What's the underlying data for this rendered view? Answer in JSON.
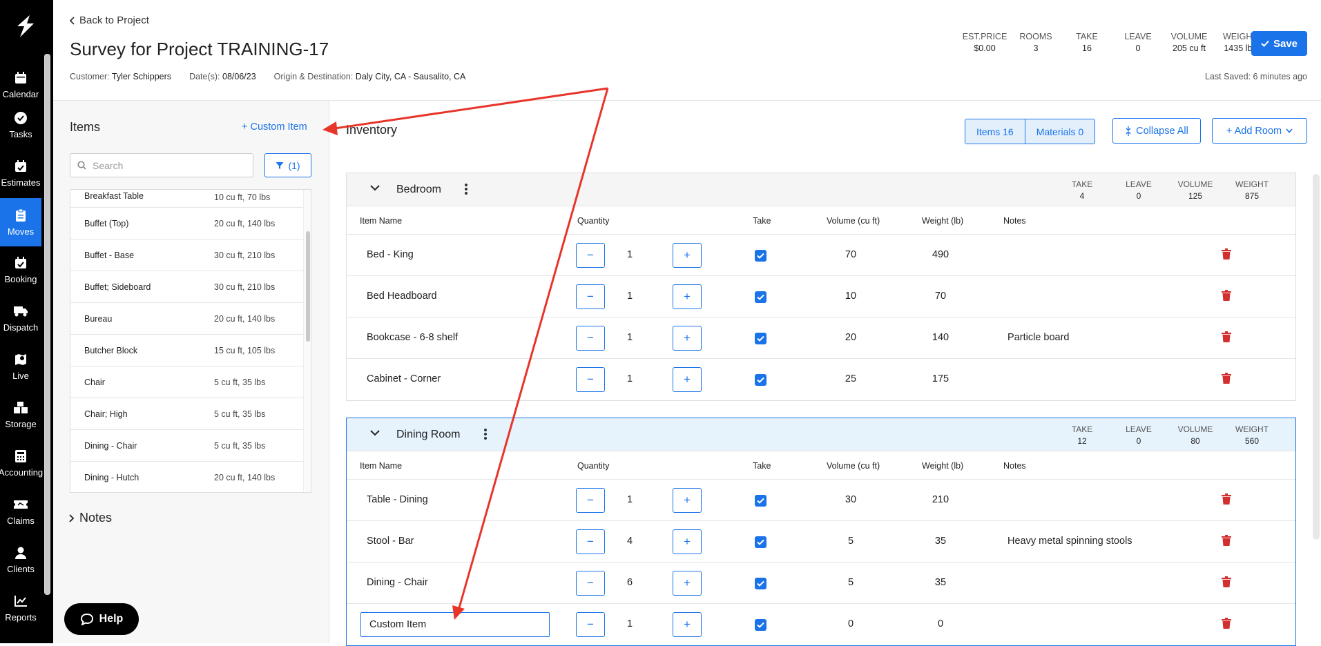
{
  "nav": {
    "items": [
      {
        "label": "Calendar",
        "icon": "calendar-icon"
      },
      {
        "label": "Tasks",
        "icon": "check-circle-icon"
      },
      {
        "label": "Estimates",
        "icon": "calendar-check-icon"
      },
      {
        "label": "Moves",
        "icon": "clipboard-icon",
        "active": true
      },
      {
        "label": "Booking",
        "icon": "calendar-check-icon"
      },
      {
        "label": "Dispatch",
        "icon": "truck-icon"
      },
      {
        "label": "Live",
        "icon": "map-pin-icon"
      },
      {
        "label": "Storage",
        "icon": "boxes-icon"
      },
      {
        "label": "Accounting",
        "icon": "calculator-icon"
      },
      {
        "label": "Claims",
        "icon": "ticket-icon"
      },
      {
        "label": "Clients",
        "icon": "user-icon"
      },
      {
        "label": "Reports",
        "icon": "chart-line-icon"
      }
    ]
  },
  "header": {
    "back_label": "Back to Project",
    "title": "Survey for Project TRAINING-17",
    "customer_label": "Customer:",
    "customer": "Tyler Schippers",
    "dates_label": "Date(s):",
    "dates": "08/06/23",
    "origin_label": "Origin & Destination:",
    "origin": "Daly City, CA - Sausalito, CA",
    "stats": [
      {
        "label": "EST.PRICE",
        "value": "$0.00"
      },
      {
        "label": "ROOMS",
        "value": "3"
      },
      {
        "label": "TAKE",
        "value": "16"
      },
      {
        "label": "LEAVE",
        "value": "0"
      },
      {
        "label": "VOLUME",
        "value": "205 cu ft"
      },
      {
        "label": "WEIGHT",
        "value": "1435 lbs"
      }
    ],
    "save_label": "Save",
    "last_saved": "Last Saved: 6 minutes ago"
  },
  "items_panel": {
    "title": "Items",
    "custom_item_label": "+ Custom Item",
    "search_placeholder": "Search",
    "filter_label": "(1)",
    "items": [
      {
        "name": "Breakfast Table",
        "detail": "10 cu ft, 70 lbs"
      },
      {
        "name": "Buffet (Top)",
        "detail": "20 cu ft, 140 lbs"
      },
      {
        "name": "Buffet - Base",
        "detail": "30 cu ft, 210 lbs"
      },
      {
        "name": "Buffet; Sideboard",
        "detail": "30 cu ft, 210 lbs"
      },
      {
        "name": "Bureau",
        "detail": "20 cu ft, 140 lbs"
      },
      {
        "name": "Butcher Block",
        "detail": "15 cu ft, 105 lbs"
      },
      {
        "name": "Chair",
        "detail": "5 cu ft, 35 lbs"
      },
      {
        "name": "Chair; High",
        "detail": "5 cu ft, 35 lbs"
      },
      {
        "name": "Dining - Chair",
        "detail": "5 cu ft, 35 lbs"
      },
      {
        "name": "Dining - Hutch",
        "detail": "20 cu ft, 140 lbs"
      }
    ],
    "notes_label": "Notes",
    "help_label": "Help"
  },
  "inventory": {
    "title": "Inventory",
    "items_tab": "Items 16",
    "materials_tab": "Materials 0",
    "collapse_label": "Collapse All",
    "add_room_label": "+ Add Room",
    "columns": {
      "name": "Item Name",
      "quantity": "Quantity",
      "take": "Take",
      "volume": "Volume (cu ft)",
      "weight": "Weight (lb)",
      "notes": "Notes"
    },
    "stat_labels": {
      "take": "TAKE",
      "leave": "LEAVE",
      "volume": "VOLUME",
      "weight": "WEIGHT"
    },
    "rooms": [
      {
        "name": "Bedroom",
        "take": "4",
        "leave": "0",
        "volume": "125",
        "weight": "875",
        "items": [
          {
            "name": "Bed - King",
            "qty": "1",
            "volume": "70",
            "weight": "490",
            "notes": ""
          },
          {
            "name": "Bed Headboard",
            "qty": "1",
            "volume": "10",
            "weight": "70",
            "notes": ""
          },
          {
            "name": "Bookcase - 6-8 shelf",
            "qty": "1",
            "volume": "20",
            "weight": "140",
            "notes": "Particle board"
          },
          {
            "name": "Cabinet - Corner",
            "qty": "1",
            "volume": "25",
            "weight": "175",
            "notes": ""
          }
        ]
      },
      {
        "name": "Dining Room",
        "take": "12",
        "leave": "0",
        "volume": "80",
        "weight": "560",
        "items": [
          {
            "name": "Table - Dining",
            "qty": "1",
            "volume": "30",
            "weight": "210",
            "notes": ""
          },
          {
            "name": "Stool - Bar",
            "qty": "4",
            "volume": "5",
            "weight": "35",
            "notes": "Heavy metal spinning stools"
          },
          {
            "name": "Dining - Chair",
            "qty": "6",
            "volume": "5",
            "weight": "35",
            "notes": ""
          },
          {
            "name": "Custom Item",
            "qty": "1",
            "volume": "0",
            "weight": "0",
            "notes": "",
            "editable": true
          }
        ]
      }
    ]
  },
  "colors": {
    "accent": "#1a73e8",
    "danger": "#d32f2f",
    "annotation": "#e8352a",
    "nav_bg": "#000000"
  }
}
